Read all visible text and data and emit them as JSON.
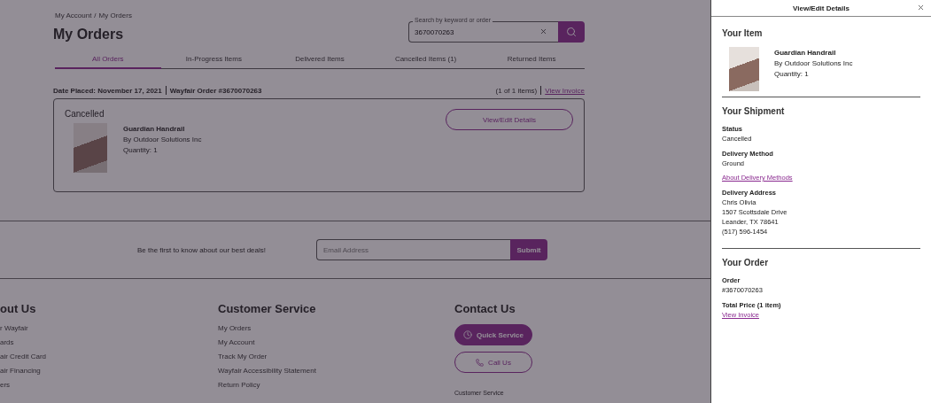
{
  "breadcrumb": {
    "items": [
      "My Account",
      "My Orders"
    ],
    "separator": "/"
  },
  "page_title": "My Orders",
  "search": {
    "label": "Search by keyword or order",
    "value": "3670070263"
  },
  "tabs": [
    {
      "label": "All Orders",
      "selected": true
    },
    {
      "label": "In-Progress Items",
      "selected": false
    },
    {
      "label": "Delivered Items",
      "selected": false
    },
    {
      "label": "Cancelled Items (1)",
      "selected": false
    },
    {
      "label": "Returned Items",
      "selected": false
    }
  ],
  "order": {
    "date_placed": "Date Placed: November 17, 2021",
    "order_number": "Wayfair Order #3670070263",
    "item_count": "(1 of 1 items)",
    "invoice_link": "View Invoice",
    "status": "Cancelled",
    "action": "View/Edit Details",
    "item": {
      "name": "Guardian Handrail",
      "brand": "By Outdoor Solutions Inc",
      "quantity": "Quantity: 1"
    }
  },
  "newsletter": {
    "text": "Be the first to know about our best deals!",
    "placeholder": "Email Address",
    "button": "Submit"
  },
  "footer": {
    "columns": [
      {
        "title": "out Us",
        "links": [
          "r Wayfair",
          "ards",
          "air Credit Card",
          "air Financing",
          "ers"
        ]
      },
      {
        "title": "Customer Service",
        "links": [
          "My Orders",
          "My Account",
          "Track My Order",
          "Wayfair Accessibility Statement",
          "Return Policy"
        ]
      },
      {
        "title": "Contact Us",
        "buttons": [
          {
            "label": "Quick Service",
            "kind": "primary"
          },
          {
            "label": "Call Us",
            "kind": "outline"
          }
        ],
        "subheading": "Customer Service"
      }
    ]
  },
  "drawer": {
    "title": "View/Edit Details",
    "sections": [
      {
        "heading": "Your Item",
        "item": {
          "name": "Guardian Handrail",
          "brand": "By Outdoor Solutions Inc",
          "quantity": "Quantity: 1"
        }
      },
      {
        "heading": "Your Shipment",
        "fields": [
          {
            "label": "Status",
            "lines": [
              "Cancelled"
            ]
          },
          {
            "label": "Delivery Method",
            "lines": [
              "Ground"
            ],
            "link": "About Delivery Methods"
          },
          {
            "label": "Delivery Address",
            "lines": [
              "Chris Olivia",
              "1507 Scottsdale Drive",
              "Leander, TX 78641",
              "(517) 596-1454"
            ]
          }
        ]
      },
      {
        "heading": "Your Order",
        "fields": [
          {
            "label": "Order",
            "lines": [
              "#3670070263"
            ]
          },
          {
            "label": "Total Price (1 item)",
            "link": "View Invoice"
          }
        ]
      }
    ]
  }
}
